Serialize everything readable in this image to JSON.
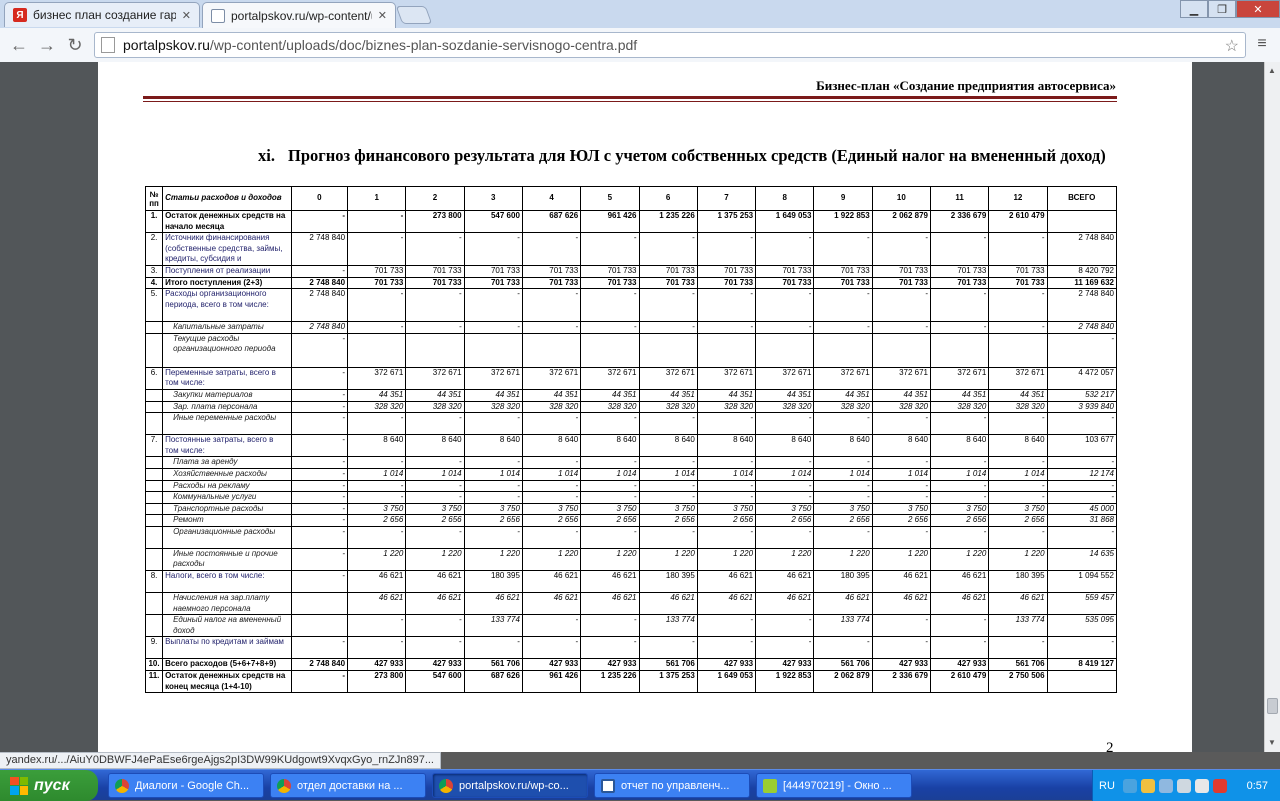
{
  "browser": {
    "tabs": [
      {
        "title": "бизнес план создание гара",
        "favicon": "yandex-icon",
        "color": "#d62a1f"
      },
      {
        "title": "portalpskov.ru/wp-content/u",
        "favicon": "page-icon",
        "color": "#7c8da6"
      }
    ],
    "url_domain": "portalpskov.ru",
    "url_path": "/wp-content/uploads/doc/biznes-plan-sozdanie-servisnogo-centra.pdf",
    "status_url": "yandex.ru/.../AiuY0DBWFJ4ePaEse6rgeAjgs2pI3DW99KUdgowt9XvqxGyo_rnZJn897..."
  },
  "document": {
    "header": "Бизнес-план «Создание предприятия автосервиса»",
    "section_number": "xi.",
    "section_title": "Прогноз финансового результата для ЮЛ с учетом собственных средств (Единый налог на вмененный доход)",
    "page_number": "2",
    "table": {
      "col_no": "№ пп",
      "col_item": "Статьи расходов и доходов",
      "months": [
        "0",
        "1",
        "2",
        "3",
        "4",
        "5",
        "6",
        "7",
        "8",
        "9",
        "10",
        "11",
        "12"
      ],
      "col_total": "ВСЕГО",
      "rows": [
        {
          "n": "1.",
          "label": "Остаток денежных средств на начало месяца",
          "style": "bold",
          "v": [
            "-",
            "-",
            "273 800",
            "547 600",
            "687 626",
            "961 426",
            "1 235 226",
            "1 375 253",
            "1 649 053",
            "1 922 853",
            "2 062 879",
            "2 336 679",
            "2 610 479",
            ""
          ],
          "h": 22
        },
        {
          "n": "2.",
          "label": "Источники финансирования (собственные средства, займы, кредиты, субсидия и",
          "style": "",
          "v": [
            "2 748 840",
            "-",
            "-",
            "-",
            "-",
            "-",
            "-",
            "-",
            "-",
            "-",
            "-",
            "-",
            "-",
            "2 748 840"
          ],
          "h": 32
        },
        {
          "n": "3.",
          "label": "Поступления от реализации",
          "style": "",
          "v": [
            "-",
            "701 733",
            "701 733",
            "701 733",
            "701 733",
            "701 733",
            "701 733",
            "701 733",
            "701 733",
            "701 733",
            "701 733",
            "701 733",
            "701 733",
            "8 420 792"
          ],
          "h": 11
        },
        {
          "n": "4.",
          "label": "Итого поступления (2+3)",
          "style": "bold",
          "v": [
            "2 748 840",
            "701 733",
            "701 733",
            "701 733",
            "701 733",
            "701 733",
            "701 733",
            "701 733",
            "701 733",
            "701 733",
            "701 733",
            "701 733",
            "701 733",
            "11 169 632"
          ],
          "h": 11
        },
        {
          "n": "5.",
          "label": "Расходы организационного периода, всего в том числе:",
          "style": "",
          "v": [
            "2 748 840",
            "-",
            "-",
            "-",
            "-",
            "-",
            "-",
            "-",
            "-",
            "-",
            "-",
            "-",
            "-",
            "2 748 840"
          ],
          "h": 33
        },
        {
          "n": "",
          "label": "Капитальные затраты",
          "style": "it",
          "v": [
            "2 748 840",
            "-",
            "-",
            "-",
            "-",
            "-",
            "-",
            "-",
            "-",
            "-",
            "-",
            "-",
            "-",
            "2 748 840"
          ],
          "h": 11
        },
        {
          "n": "",
          "label": "Текущие расходы организационного периода",
          "style": "it",
          "v": [
            "-",
            "",
            "",
            "",
            "",
            "",
            "",
            "",
            "",
            "",
            "",
            "",
            "",
            "-"
          ],
          "h": 34
        },
        {
          "n": "6.",
          "label": "Переменные затраты, всего в том числе:",
          "style": "",
          "v": [
            "-",
            "372 671",
            "372 671",
            "372 671",
            "372 671",
            "372 671",
            "372 671",
            "372 671",
            "372 671",
            "372 671",
            "372 671",
            "372 671",
            "372 671",
            "4 472 057"
          ],
          "h": 22
        },
        {
          "n": "",
          "label": "Закупки материалов",
          "style": "it",
          "v": [
            "-",
            "44 351",
            "44 351",
            "44 351",
            "44 351",
            "44 351",
            "44 351",
            "44 351",
            "44 351",
            "44 351",
            "44 351",
            "44 351",
            "44 351",
            "532 217"
          ],
          "h": 11
        },
        {
          "n": "",
          "label": "Зар. плата персонала",
          "style": "it",
          "v": [
            "-",
            "328 320",
            "328 320",
            "328 320",
            "328 320",
            "328 320",
            "328 320",
            "328 320",
            "328 320",
            "328 320",
            "328 320",
            "328 320",
            "328 320",
            "3 939 840"
          ],
          "h": 11
        },
        {
          "n": "",
          "label": "Иные переменные расходы",
          "style": "it",
          "v": [
            "-",
            "-",
            "-",
            "-",
            "-",
            "-",
            "-",
            "-",
            "-",
            "-",
            "-",
            "-",
            "-",
            "-"
          ],
          "h": 22
        },
        {
          "n": "7.",
          "label": "Постоянные затраты, всего в том числе:",
          "style": "",
          "v": [
            "-",
            "8 640",
            "8 640",
            "8 640",
            "8 640",
            "8 640",
            "8 640",
            "8 640",
            "8 640",
            "8 640",
            "8 640",
            "8 640",
            "8 640",
            "103 677"
          ],
          "h": 22
        },
        {
          "n": "",
          "label": "Плата за аренду",
          "style": "it",
          "v": [
            "-",
            "-",
            "-",
            "-",
            "-",
            "-",
            "-",
            "-",
            "-",
            "-",
            "-",
            "-",
            "-",
            "-"
          ],
          "h": 11
        },
        {
          "n": "",
          "label": "Хозяйственные расходы",
          "style": "it",
          "v": [
            "-",
            "1 014",
            "1 014",
            "1 014",
            "1 014",
            "1 014",
            "1 014",
            "1 014",
            "1 014",
            "1 014",
            "1 014",
            "1 014",
            "1 014",
            "12 174"
          ],
          "h": 11
        },
        {
          "n": "",
          "label": "Расходы на рекламу",
          "style": "it",
          "v": [
            "-",
            "-",
            "-",
            "-",
            "-",
            "-",
            "-",
            "-",
            "-",
            "-",
            "-",
            "-",
            "-",
            "-"
          ],
          "h": 11
        },
        {
          "n": "",
          "label": "Коммунальные услуги",
          "style": "it",
          "v": [
            "-",
            "-",
            "-",
            "-",
            "-",
            "-",
            "-",
            "-",
            "-",
            "-",
            "-",
            "-",
            "-",
            "-"
          ],
          "h": 11
        },
        {
          "n": "",
          "label": "Транспортные расходы",
          "style": "it",
          "v": [
            "-",
            "3 750",
            "3 750",
            "3 750",
            "3 750",
            "3 750",
            "3 750",
            "3 750",
            "3 750",
            "3 750",
            "3 750",
            "3 750",
            "3 750",
            "45 000"
          ],
          "h": 11
        },
        {
          "n": "",
          "label": "Ремонт",
          "style": "it",
          "v": [
            "-",
            "2 656",
            "2 656",
            "2 656",
            "2 656",
            "2 656",
            "2 656",
            "2 656",
            "2 656",
            "2 656",
            "2 656",
            "2 656",
            "2 656",
            "31 868"
          ],
          "h": 11
        },
        {
          "n": "",
          "label": "Организационные расходы",
          "style": "it",
          "v": [
            "-",
            "-",
            "-",
            "-",
            "-",
            "-",
            "-",
            "-",
            "-",
            "-",
            "-",
            "-",
            "-",
            "-"
          ],
          "h": 22
        },
        {
          "n": "",
          "label": "Иные постоянные и прочие расходы",
          "style": "it",
          "v": [
            "-",
            "1 220",
            "1 220",
            "1 220",
            "1 220",
            "1 220",
            "1 220",
            "1 220",
            "1 220",
            "1 220",
            "1 220",
            "1 220",
            "1 220",
            "14 635"
          ],
          "h": 22
        },
        {
          "n": "8.",
          "label": "Налоги, всего в том числе:",
          "style": "",
          "v": [
            "-",
            "46 621",
            "46 621",
            "180 395",
            "46 621",
            "46 621",
            "180 395",
            "46 621",
            "46 621",
            "180 395",
            "46 621",
            "46 621",
            "180 395",
            "1 094 552"
          ],
          "h": 22
        },
        {
          "n": "",
          "label": "Начисления на зар.плату наемного персонала",
          "style": "it",
          "v": [
            "",
            "46 621",
            "46 621",
            "46 621",
            "46 621",
            "46 621",
            "46 621",
            "46 621",
            "46 621",
            "46 621",
            "46 621",
            "46 621",
            "46 621",
            "559 457"
          ],
          "h": 22
        },
        {
          "n": "",
          "label": "Единый налог на вмененный доход",
          "style": "it",
          "v": [
            "",
            "-",
            "-",
            "133 774",
            "-",
            "-",
            "133 774",
            "-",
            "-",
            "133 774",
            "-",
            "-",
            "133 774",
            "535 095"
          ],
          "h": 22
        },
        {
          "n": "9.",
          "label": "Выплаты по кредитам и займам",
          "style": "",
          "v": [
            "-",
            "-",
            "-",
            "-",
            "-",
            "-",
            "-",
            "-",
            "-",
            "-",
            "-",
            "-",
            "-",
            "-"
          ],
          "h": 22
        },
        {
          "n": "10.",
          "label": "Всего расходов (5+6+7+8+9)",
          "style": "bold",
          "v": [
            "2 748 840",
            "427 933",
            "427 933",
            "561 706",
            "427 933",
            "427 933",
            "561 706",
            "427 933",
            "427 933",
            "561 706",
            "427 933",
            "427 933",
            "561 706",
            "8 419 127"
          ],
          "h": 11
        },
        {
          "n": "11.",
          "label": "Остаток денежных средств на конец месяца (1+4-10)",
          "style": "bold",
          "v": [
            "-",
            "273 800",
            "547 600",
            "687 626",
            "961 426",
            "1 235 226",
            "1 375 253",
            "1 649 053",
            "1 922 853",
            "2 062 879",
            "2 336 679",
            "2 610 479",
            "2 750 506",
            ""
          ],
          "h": 22
        }
      ]
    }
  },
  "taskbar": {
    "start_label": "пуск",
    "tasks": [
      {
        "label": "Диалоги - Google Ch...",
        "icon": "chrome-icon"
      },
      {
        "label": "отдел доставки на ...",
        "icon": "chrome-icon"
      },
      {
        "label": "portalpskov.ru/wp-co...",
        "icon": "chrome-icon"
      },
      {
        "label": "отчет по управленч...",
        "icon": "word-icon"
      },
      {
        "label": "[444970219] - Окно ...",
        "icon": "chat-icon"
      }
    ],
    "lang": "RU",
    "clock": "0:57"
  }
}
